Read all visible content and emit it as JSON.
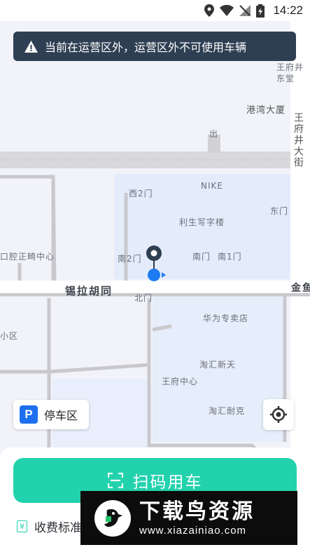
{
  "status_bar": {
    "time": "14:22"
  },
  "banner": {
    "text": "当前在运营区外，运营区外不可使用车辆"
  },
  "map": {
    "labels": {
      "wangfujing_dongtang": "王府井\n东堂",
      "gangwan": "港湾大厦",
      "chu": "出",
      "wangfujing_dajie": "王府井大街",
      "xi2men": "西2门",
      "nike": "NIKE",
      "dongmen": "东门",
      "lisheng": "利生写字楼",
      "kouqiang": "口腔正畸中心",
      "nan2men": "南2门",
      "nanmen": "南门",
      "nan1men": "南1门",
      "xila": "锡拉胡同",
      "beimen": "北门",
      "jinyu": "金鱼",
      "huawei": "华为专卖店",
      "xiaoqu": "小区",
      "taohui_xintian": "淘汇新天",
      "wangfu_center": "王府中心",
      "taohui_naike": "淘汇耐克"
    }
  },
  "parking": {
    "badge": "P",
    "label": "停车区"
  },
  "scan_button": {
    "label": "扫码用车"
  },
  "fee": {
    "icon_char": "¥",
    "label": "收费标准"
  },
  "watermark": {
    "title": "下载鸟资源",
    "url": "www.xiazainiao.com"
  },
  "colors": {
    "accent": "#22d2ad",
    "banner_bg": "#2f3f53",
    "parking_blue": "#1e6ff0"
  }
}
